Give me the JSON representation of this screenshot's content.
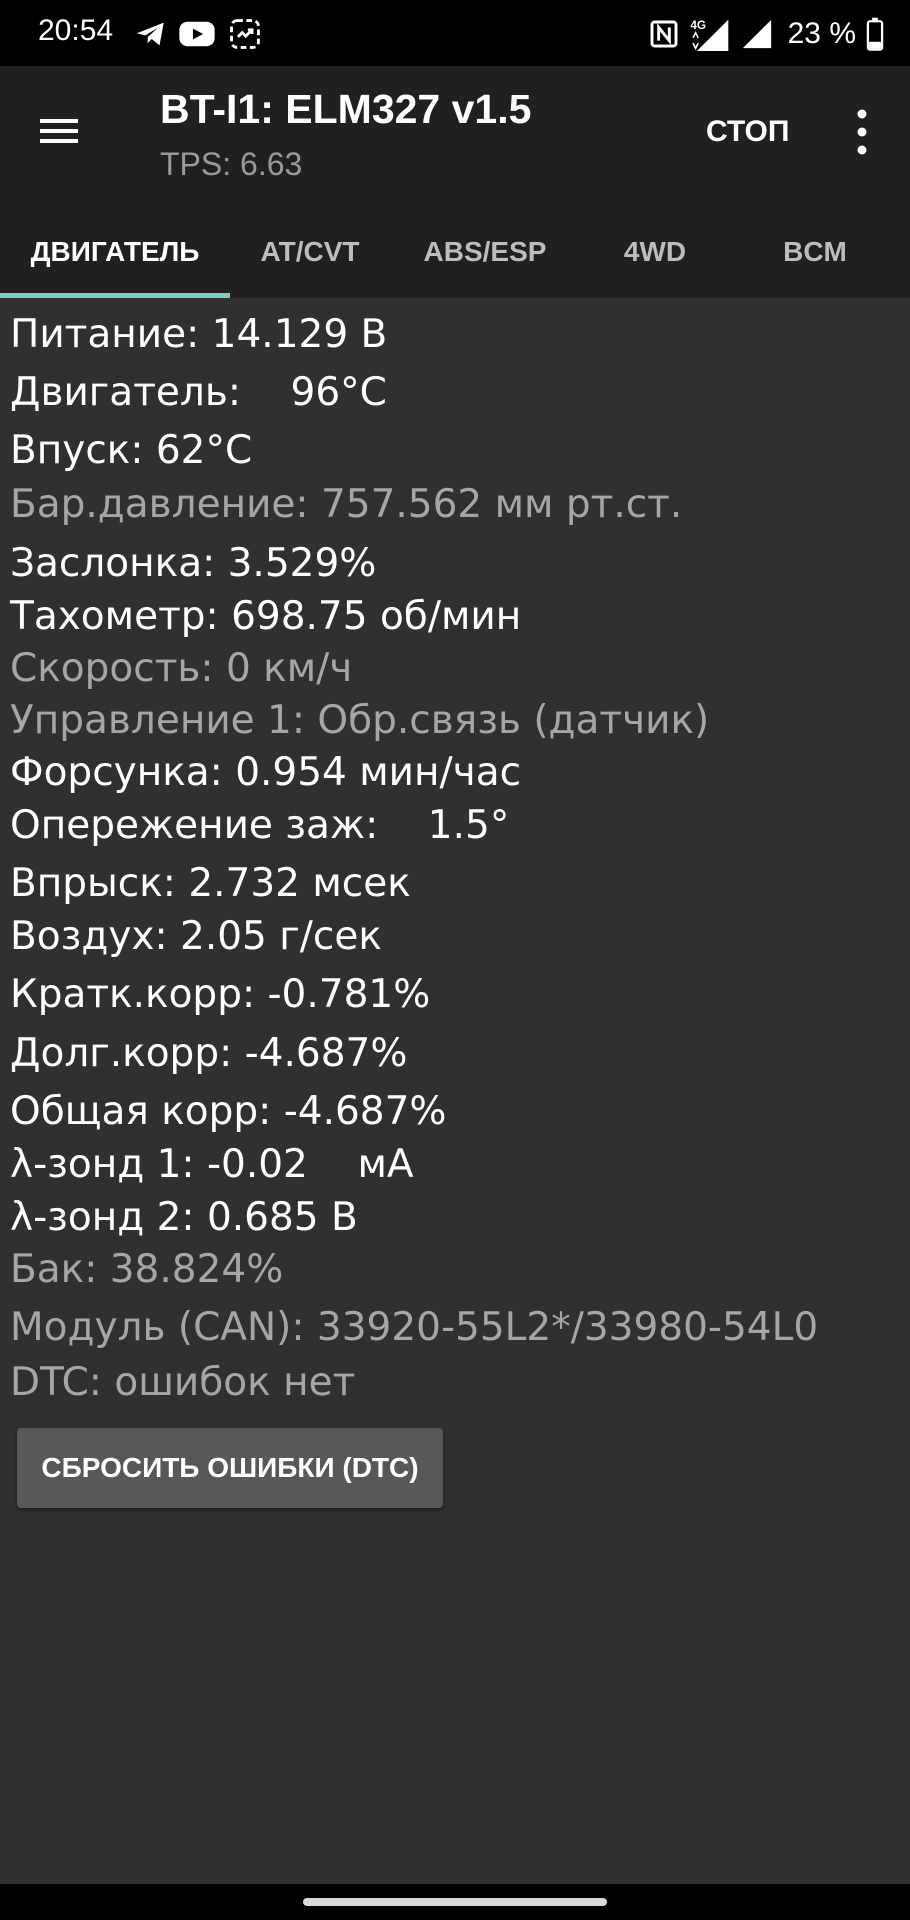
{
  "status_bar": {
    "time": "20:54",
    "left_icons": [
      "telegram-icon",
      "youtube-icon",
      "screen-record-icon"
    ],
    "right_icons": [
      "nfc-icon",
      "signal-4g-icon",
      "signal-icon",
      "battery-icon"
    ],
    "network_label": "4G",
    "battery_percent": "23 %"
  },
  "app_bar": {
    "title": "BT-I1: ELM327 v1.5",
    "subtitle": "TPS: 6.63",
    "stop_label": "СТОП"
  },
  "tabs": [
    {
      "label": "ДВИГАТЕЛЬ",
      "active": true
    },
    {
      "label": "AT/CVT",
      "active": false
    },
    {
      "label": "ABS/ESP",
      "active": false
    },
    {
      "label": "4WD",
      "active": false
    },
    {
      "label": "BCM",
      "active": false
    }
  ],
  "params": [
    {
      "text": "Питание: 14.129 В",
      "dim": false
    },
    {
      "text": "Двигатель:    96°C",
      "dim": false
    },
    {
      "text": "Впуск: 62°C",
      "dim": false
    },
    {
      "text": "Бар.давление: 757.562 мм рт.ст.",
      "dim": true
    },
    {
      "text": "Заслонка: 3.529%",
      "dim": false
    },
    {
      "text": "Тахометр: 698.75 об/мин",
      "dim": false
    },
    {
      "text": "Скорость: 0 км/ч",
      "dim": true
    },
    {
      "text": "Управление 1: Обр.связь (датчик)",
      "dim": true
    },
    {
      "text": "Форсунка: 0.954 мин/час",
      "dim": false
    },
    {
      "text": "Опережение заж:    1.5°",
      "dim": false
    },
    {
      "text": "Впрыск: 2.732 мсек",
      "dim": false
    },
    {
      "text": "Воздух: 2.05 г/сек",
      "dim": false
    },
    {
      "text": "Кратк.корр: -0.781%",
      "dim": false
    },
    {
      "text": "Долг.корр: -4.687%",
      "dim": false
    },
    {
      "text": "Общая корр: -4.687%",
      "dim": false
    },
    {
      "text": "λ-зонд 1: -0.02    мА",
      "dim": false
    },
    {
      "text": "λ-зонд 2: 0.685 В",
      "dim": false
    },
    {
      "text": "Бак: 38.824%",
      "dim": true
    },
    {
      "text": "Модуль (CAN): 33920-55L2*/33980-54L0",
      "dim": true
    },
    {
      "text": "DTC: ошибок нет",
      "dim": true
    }
  ],
  "reset_button_label": "СБРОСИТЬ ОШИБКИ (DTC)",
  "colors": {
    "tab_indicator": "#80cbc4",
    "app_bar_bg": "#202020",
    "content_bg": "#303030",
    "dim_text": "#a6a6a6"
  }
}
